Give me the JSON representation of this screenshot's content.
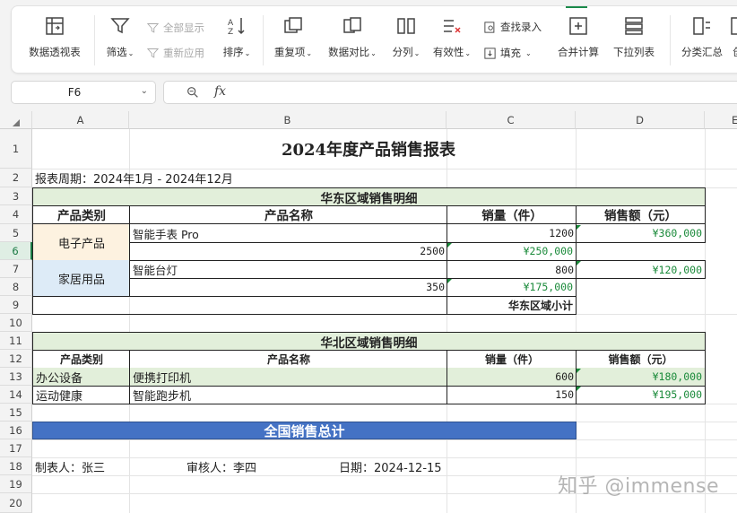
{
  "ribbon": {
    "pivot": "数据透视表",
    "filter": "筛选",
    "show_all": "全部显示",
    "reapply": "重新应用",
    "sort": "排序",
    "duplicates": "重复项",
    "compare": "数据对比",
    "split": "分列",
    "validity": "有效性",
    "lookup_entry": "查找录入",
    "fill": "填充",
    "consolidate": "合并计算",
    "dropdown_list": "下拉列表",
    "subtotal": "分类汇总",
    "partial": "创"
  },
  "formula_bar": {
    "name_box": "F6",
    "formula": ""
  },
  "columns": [
    "A",
    "B",
    "C",
    "D",
    "E"
  ],
  "rows": [
    "1",
    "2",
    "3",
    "4",
    "5",
    "6",
    "7",
    "8",
    "9",
    "10",
    "11",
    "12",
    "13",
    "14",
    "15",
    "16",
    "17",
    "18",
    "19",
    "20"
  ],
  "sheet": {
    "title": "2024年度产品销售报表",
    "period": "报表周期：2024年1月 - 2024年12月",
    "east": {
      "header": "华东区域销售明细",
      "col_category": "产品类别",
      "col_name": "产品名称",
      "col_qty": "销量（件）",
      "col_amount": "销售额（元）",
      "cat1": "电子产品",
      "r5_name": "智能手表 Pro",
      "r5_qty": "1200",
      "r5_amount": "¥360,000",
      "r6_b": "2500",
      "r6_c": "¥250,000",
      "cat2": "家居用品",
      "r7_name": "智能台灯",
      "r7_qty": "800",
      "r7_amount": "¥120,000",
      "r8_b": "350",
      "r8_c": "¥175,000",
      "subtotal": "华东区域小计"
    },
    "north": {
      "header": "华北区域销售明细",
      "col_category": "产品类别",
      "col_name": "产品名称",
      "col_qty": "销量（件）",
      "col_amount": "销售额（元）",
      "r13_cat": "办公设备",
      "r13_name": "便携打印机",
      "r13_qty": "600",
      "r13_amount": "¥180,000",
      "r14_cat": "运动健康",
      "r14_name": "智能跑步机",
      "r14_qty": "150",
      "r14_amount": "¥195,000"
    },
    "grand_total": "全国销售总计",
    "maker": "制表人：张三",
    "reviewer": "审核人：李四",
    "date": "日期：2024-12-15"
  },
  "watermark": "知乎 @immense",
  "colors": {
    "accent": "#1a8a4a",
    "header_green": "#e2efda",
    "total_blue": "#4472c4",
    "cat_orange": "#fdf2e0",
    "cat_blue": "#ddebf7"
  }
}
